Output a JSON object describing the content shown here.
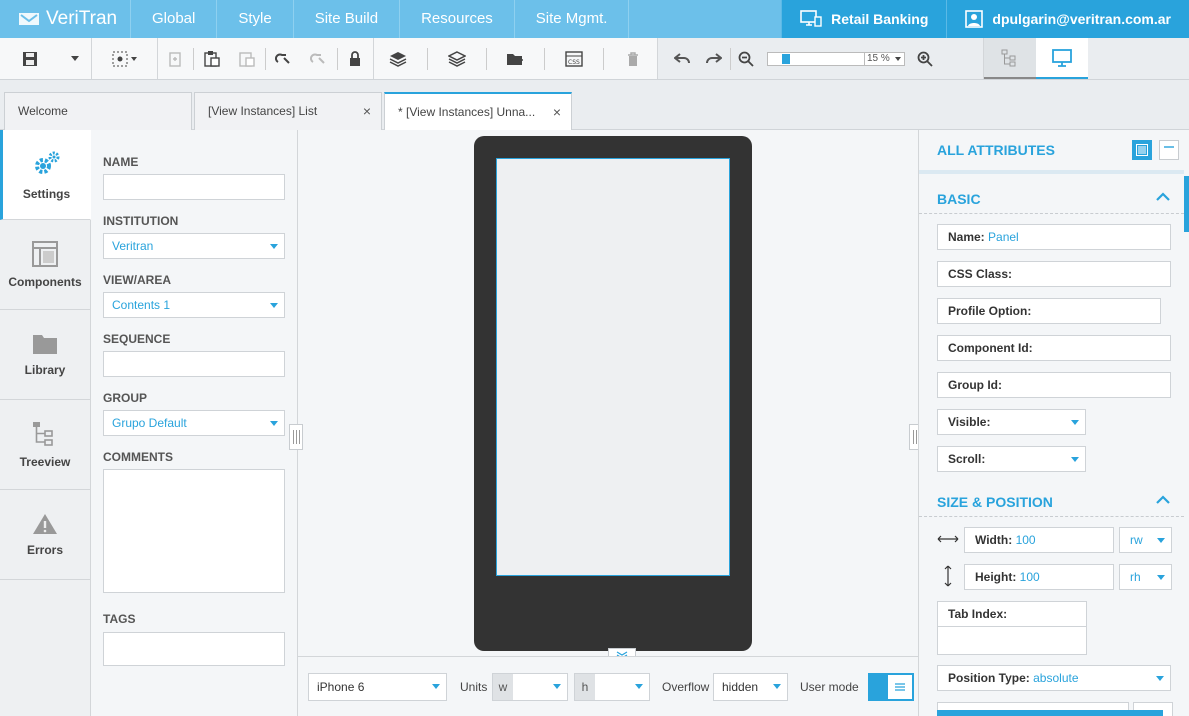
{
  "app": {
    "logo_text": "VeriTran"
  },
  "nav": {
    "items": [
      "Global",
      "Style",
      "Site Build",
      "Resources",
      "Site Mgmt."
    ]
  },
  "account": {
    "context": "Retail Banking",
    "user": "dpulgarin@veritran.com.ar"
  },
  "toolbar": {
    "zoom_value": "15 %",
    "zoom_level": 0.15
  },
  "tabs": [
    {
      "label": "Welcome"
    },
    {
      "label": "[View Instances] List"
    },
    {
      "label": "* [View Instances] Unna..."
    }
  ],
  "sidebar": {
    "items": [
      "Settings",
      "Components",
      "Library",
      "Treeview",
      "Errors"
    ]
  },
  "settings": {
    "name_label": "NAME",
    "name_value": "",
    "institution_label": "INSTITUTION",
    "institution_value": "Veritran",
    "view_label": "VIEW/AREA",
    "view_value": "Contents 1",
    "sequence_label": "SEQUENCE",
    "sequence_value": "",
    "group_label": "GROUP",
    "group_value": "Grupo Default",
    "comments_label": "COMMENTS",
    "comments_value": "",
    "tags_label": "TAGS",
    "tags_value": ""
  },
  "bottom": {
    "device": "iPhone 6",
    "units_label": "Units",
    "w_label": "w",
    "h_label": "h",
    "overflow_label": "Overflow",
    "overflow_value": "hidden",
    "user_mode_label": "User mode"
  },
  "attributes": {
    "title": "ALL ATTRIBUTES",
    "basic_title": "BASIC",
    "name_label": "Name:",
    "name_value": "Panel",
    "css_label": "CSS Class:",
    "profile_label": "Profile Option:",
    "component_label": "Component Id:",
    "group_label": "Group Id:",
    "visible_label": "Visible:",
    "scroll_label": "Scroll:",
    "size_title": "SIZE & POSITION",
    "width_label": "Width:",
    "width_value": "100",
    "width_unit": "rw",
    "height_label": "Height:",
    "height_value": "100",
    "height_unit": "rh",
    "tabindex_label": "Tab Index:",
    "position_label": "Position Type:",
    "position_value": "absolute"
  },
  "colors": {
    "accent": "#29a3dc",
    "topbar": "#6cc0ea",
    "device": "#333333"
  }
}
